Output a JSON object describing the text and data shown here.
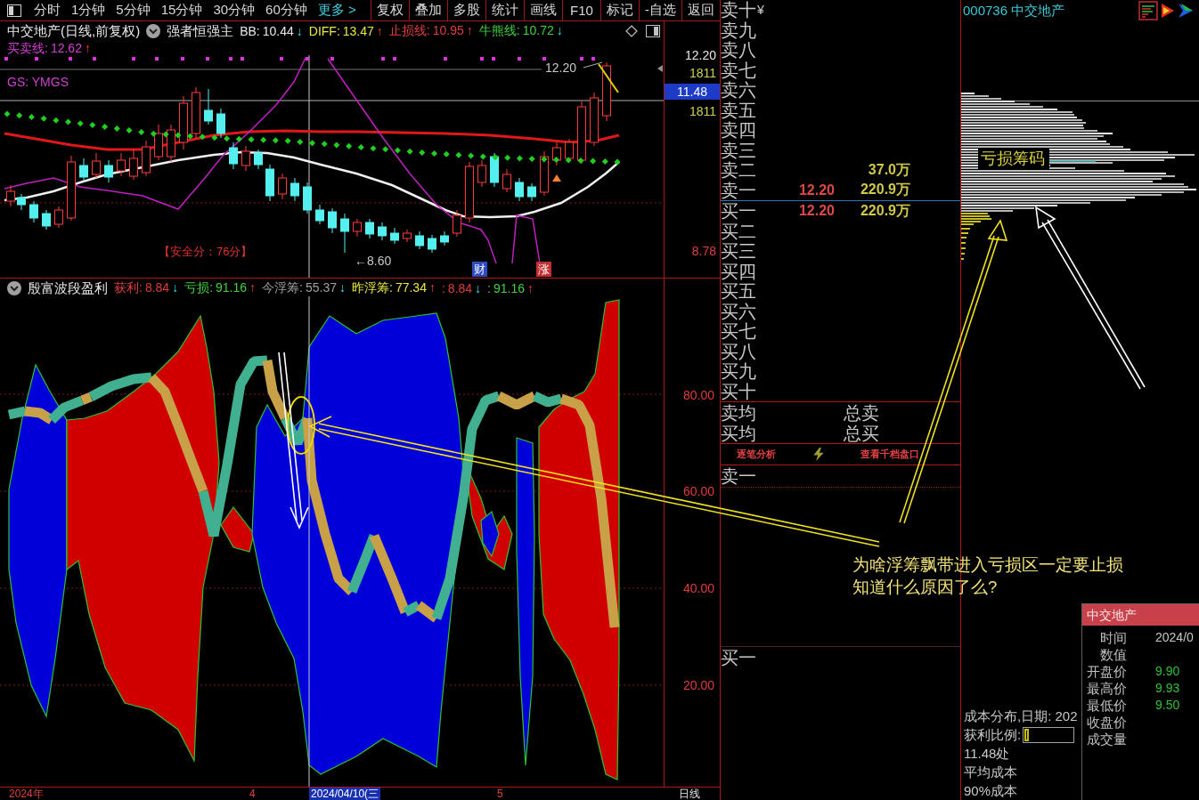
{
  "toolbar": {
    "periods": [
      "分时",
      "1分钟",
      "5分钟",
      "15分钟",
      "30分钟",
      "60分钟"
    ],
    "more": "更多 >",
    "buttons": [
      "复权",
      "叠加",
      "多股",
      "统计",
      "画线",
      "F10",
      "标记",
      "-自选",
      "返回"
    ]
  },
  "price_chart": {
    "title": "中交地产(日线,前复权)",
    "indicator": "强者恒强主",
    "readings": [
      {
        "label": "BB:",
        "value": "10.44",
        "arrow": "↓",
        "rising": false,
        "color": "#e8e8e8"
      },
      {
        "label": "DIFF:",
        "value": "13.47",
        "arrow": "↑",
        "rising": true,
        "color": "#e8e840"
      },
      {
        "label": "止损线:",
        "value": "10.95",
        "arrow": "↑",
        "rising": true,
        "color": "#e03c3c"
      },
      {
        "label": "牛熊线:",
        "value": "10.72",
        "arrow": "↓",
        "rising": false,
        "color": "#40d040"
      },
      {
        "label": "买卖线:",
        "value": "12.62",
        "arrow": "↑",
        "rising": true,
        "color": "#d040d0"
      }
    ],
    "formula": "GS: YMGS",
    "labels": [
      {
        "text": "12.20",
        "kind": "price"
      },
      {
        "text": "【安全分：76分】",
        "kind": "score"
      },
      {
        "text": "←8.60",
        "kind": "price"
      },
      {
        "text": "财",
        "kind": "badge",
        "color": "#2c4cc0"
      },
      {
        "text": "涨",
        "kind": "badge",
        "color": "#c03030"
      }
    ],
    "axis": [
      {
        "text": "12.20",
        "kind": "price"
      },
      {
        "text": "1811",
        "kind": "volume"
      },
      {
        "text": "11.48",
        "kind": "cursor"
      },
      {
        "text": "1811",
        "kind": "volume"
      },
      {
        "text": "8.78",
        "kind": "low"
      }
    ]
  },
  "band_chart": {
    "title": "殷富波段盈利",
    "readings": [
      {
        "label": "获利:",
        "value": "8.84",
        "arrow": "↓",
        "rising": false,
        "color": "#e03c3c"
      },
      {
        "label": "亏损:",
        "value": "91.16",
        "arrow": "↑",
        "rising": true,
        "color": "#40d040"
      },
      {
        "label": "今浮筹:",
        "value": "55.37",
        "arrow": "↓",
        "rising": false,
        "color": "#a0a0a0"
      },
      {
        "label": "昨浮筹:",
        "value": "77.34",
        "arrow": "↑",
        "rising": true,
        "color": "#e8e840"
      },
      {
        "label": ":",
        "value": "8.84",
        "arrow": "↓",
        "rising": false,
        "color": "#e03c3c"
      },
      {
        "label": ":",
        "value": "91.16",
        "arrow": "↑",
        "rising": true,
        "color": "#40d040"
      }
    ],
    "axis": [
      "80.00",
      "60.00",
      "40.00",
      "20.00"
    ]
  },
  "date_axis": [
    {
      "text": "2024年",
      "kind": "year"
    },
    {
      "text": "4",
      "kind": "month"
    },
    {
      "text": "2024/04/10(三",
      "kind": "cursor"
    },
    {
      "text": "5",
      "kind": "month"
    },
    {
      "text": "日线",
      "kind": "period"
    }
  ],
  "order_book": {
    "currency": "¥",
    "asks": [
      {
        "label": "卖十"
      },
      {
        "label": "卖九"
      },
      {
        "label": "卖八"
      },
      {
        "label": "卖七"
      },
      {
        "label": "卖六"
      },
      {
        "label": "卖五"
      },
      {
        "label": "卖四"
      },
      {
        "label": "卖三"
      },
      {
        "label": "卖二",
        "volume": "37.0万"
      },
      {
        "label": "卖一",
        "price": "12.20",
        "volume": "220.9万"
      }
    ],
    "bids": [
      {
        "label": "买一",
        "price": "12.20",
        "volume": "220.9万"
      },
      {
        "label": "买二"
      },
      {
        "label": "买三"
      },
      {
        "label": "买四"
      },
      {
        "label": "买五"
      },
      {
        "label": "买六"
      },
      {
        "label": "买七"
      },
      {
        "label": "买八"
      },
      {
        "label": "买九"
      },
      {
        "label": "买十"
      }
    ],
    "summary": [
      {
        "label": "卖均",
        "total": "总卖"
      },
      {
        "label": "买均",
        "total": "总买"
      }
    ],
    "links": [
      "逐笔分析",
      "查看千档盘口"
    ],
    "quote_rows": [
      "卖一",
      "买一"
    ]
  },
  "chip_panel": {
    "title": "000736 中交地产",
    "zone_label": "亏损筹码",
    "info": {
      "date": "成本分布,日期: 202",
      "ratio_label": "获利比例:",
      "profit_bar": {
        "level": 0.09
      },
      "lines": [
        "11.48处",
        "平均成本",
        "90%成本"
      ]
    }
  },
  "popup": {
    "title": "中交地产",
    "rows": [
      {
        "label": "时间",
        "value": "2024/0",
        "kind": "date"
      },
      {
        "label": "数值"
      },
      {
        "label": "开盘价",
        "value": "9.90",
        "kind": "price"
      },
      {
        "label": "最高价",
        "value": "9.93",
        "kind": "price"
      },
      {
        "label": "最低价",
        "value": "9.50",
        "kind": "price"
      },
      {
        "label": "收盘价"
      },
      {
        "label": "成交量"
      }
    ]
  },
  "annotation": {
    "lines": [
      "为啥浮筹飘带进入亏损区一定要止损",
      "知道什么原因了么?"
    ]
  }
}
